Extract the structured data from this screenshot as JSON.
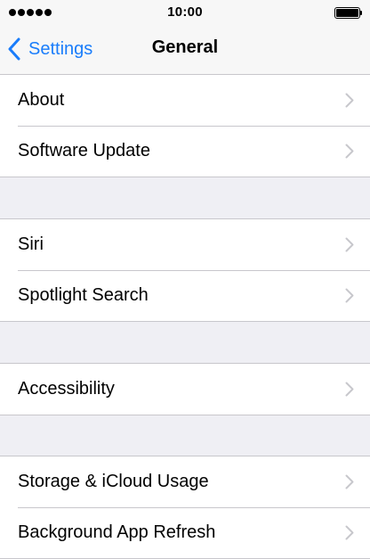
{
  "status_bar": {
    "time": "10:00",
    "signal_icon": "signal-dots-icon",
    "battery_icon": "battery-full-icon"
  },
  "nav": {
    "back_label": "Settings",
    "back_icon": "chevron-left-icon",
    "title": "General"
  },
  "groups": [
    {
      "items": [
        {
          "label": "About"
        },
        {
          "label": "Software Update"
        }
      ]
    },
    {
      "items": [
        {
          "label": "Siri"
        },
        {
          "label": "Spotlight Search"
        }
      ]
    },
    {
      "items": [
        {
          "label": "Accessibility"
        }
      ]
    },
    {
      "items": [
        {
          "label": "Storage & iCloud Usage"
        },
        {
          "label": "Background App Refresh"
        }
      ]
    }
  ],
  "row_icon": "chevron-right-icon",
  "colors": {
    "accent": "#1a7dfb",
    "background": "#efeff4",
    "bar": "#f7f7f7",
    "separator": "#c8c7cc",
    "chevron": "#c7c7cc"
  }
}
